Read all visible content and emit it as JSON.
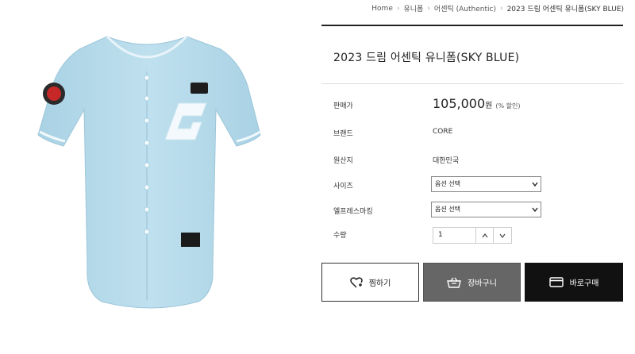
{
  "breadcrumb": {
    "items": [
      "Home",
      "유니폼",
      "어센틱 (Authentic)",
      "2023 드림 어센틱 유니폼(SKY BLUE)"
    ]
  },
  "product": {
    "title": "2023 드림 어센틱 유니폼(SKY BLUE)",
    "image_alt": "sky blue baseball jersey",
    "jersey_color": "#b8dcea",
    "price_label": "판매가",
    "price_value": "105,000",
    "price_unit": "원",
    "discount": "(% 할인)",
    "brand_label": "브랜드",
    "brand_value": "CORE",
    "origin_label": "원산지",
    "origin_value": "대한민국",
    "size_label": "사이즈",
    "size_select": "옵션 선택",
    "marking_label": "엘프레스마킹",
    "marking_select": "옵션 선택",
    "qty_label": "수량",
    "qty_value": "1"
  },
  "buttons": {
    "wish": "찜하기",
    "cart": "장바구니",
    "buy": "바로구매"
  },
  "colors": {
    "cart_bg": "#666666",
    "buy_bg": "#111111"
  }
}
